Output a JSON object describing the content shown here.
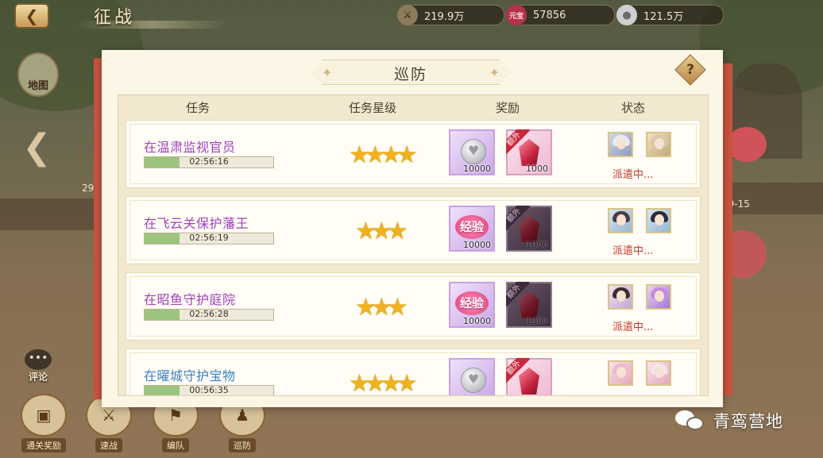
{
  "header": {
    "back_icon": "back-arrow-icon",
    "title": "征战",
    "resources": [
      {
        "icon": "crossed-swords-icon",
        "value": "219.9万"
      },
      {
        "icon": "ingot-icon",
        "glyph": "元宝",
        "value": "57856"
      },
      {
        "icon": "silver-coin-icon",
        "value": "121.5万"
      }
    ]
  },
  "side": {
    "map_label": "地图",
    "stage_left": "29-",
    "stage_right": "29-15",
    "comment_label": "评论"
  },
  "bottom_nav": [
    {
      "label": "通关奖励",
      "icon": "chest-icon"
    },
    {
      "label": "速战",
      "icon": "crossed-swords-icon"
    },
    {
      "label": "编队",
      "icon": "formation-icon"
    },
    {
      "label": "巡防",
      "icon": "patrol-icon"
    }
  ],
  "dialog": {
    "title": "巡防",
    "help_glyph": "?",
    "columns": {
      "task": "任务",
      "stars": "任务星级",
      "reward": "奖励",
      "status": "状态"
    },
    "rows": [
      {
        "name": "在温肃监视官员",
        "name_color": "#a23fc0",
        "timer": "02:56:16",
        "progress": 0.27,
        "stars": 4,
        "rewards": [
          {
            "type": "silver",
            "style": "purple",
            "qty": "10000"
          },
          {
            "type": "gem",
            "style": "pink",
            "qty": "1000",
            "tag": "额外"
          }
        ],
        "avatars": [
          "av-a",
          "av-b"
        ],
        "status": "派遣中..."
      },
      {
        "name": "在飞云关保护藩王",
        "name_color": "#a23fc0",
        "timer": "02:56:19",
        "progress": 0.27,
        "stars": 3,
        "rewards": [
          {
            "type": "exp",
            "style": "purple",
            "qty": "10000",
            "glyph": "经验"
          },
          {
            "type": "gem",
            "style": "dark",
            "qty": "1000",
            "tag": "额外"
          }
        ],
        "avatars": [
          "av-c",
          "av-d"
        ],
        "status": "派遣中..."
      },
      {
        "name": "在昭鱼守护庭院",
        "name_color": "#a23fc0",
        "timer": "02:56:28",
        "progress": 0.27,
        "stars": 3,
        "rewards": [
          {
            "type": "exp",
            "style": "purple",
            "qty": "10000",
            "glyph": "经验"
          },
          {
            "type": "gem",
            "style": "dark",
            "qty": "1000",
            "tag": "额外"
          }
        ],
        "avatars": [
          "av-e",
          "av-f"
        ],
        "status": "派遣中..."
      },
      {
        "name": "在曜城守护宝物",
        "name_color": "#3d7fc3",
        "timer": "00:56:35",
        "progress": 0.27,
        "stars": 4,
        "rewards": [
          {
            "type": "silver",
            "style": "purple",
            "qty": "",
            "tag": ""
          },
          {
            "type": "gem",
            "style": "pink",
            "qty": "",
            "tag": "额外"
          }
        ],
        "avatars": [
          "av-g",
          "av-h"
        ],
        "status": ""
      }
    ]
  },
  "watermark": {
    "icon": "wechat-icon",
    "text": "青鸾营地"
  }
}
